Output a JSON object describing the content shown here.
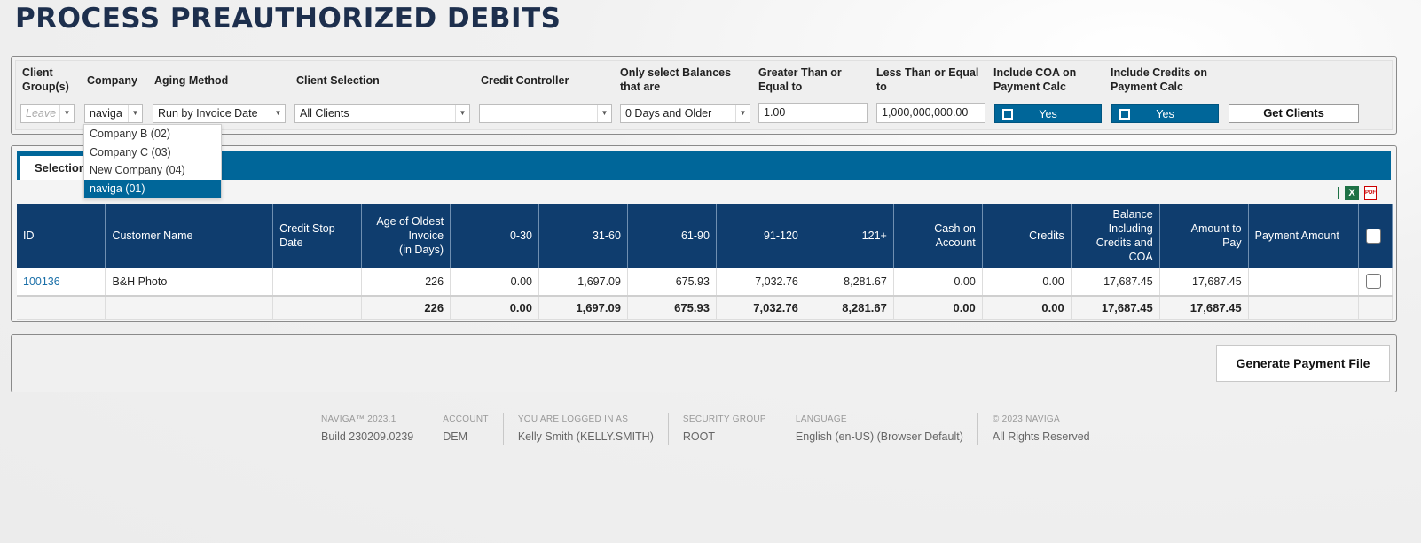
{
  "page": {
    "title": "PROCESS PREAUTHORIZED DEBITS"
  },
  "filters": {
    "client_groups": {
      "label_line1": "Client",
      "label_line2": "Group(s)",
      "placeholder": "Leave ..."
    },
    "company": {
      "label": "Company",
      "value": "naviga"
    },
    "aging_method": {
      "label": "Aging Method",
      "value": "Run by Invoice Date"
    },
    "client_selection": {
      "label": "Client Selection",
      "value": "All Clients"
    },
    "credit_controller": {
      "label": "Credit Controller",
      "value": ""
    },
    "balances": {
      "label_line1": "Only select Balances",
      "label_line2": "that are",
      "value": "0 Days and Older"
    },
    "greater_than": {
      "label_line1": "Greater Than or",
      "label_line2": "Equal to",
      "value": "1.00"
    },
    "less_than": {
      "label_line1": "Less Than or Equal",
      "label_line2": "to",
      "value": "1,000,000,000.00"
    },
    "include_coa": {
      "label_line1": "Include COA on",
      "label_line2": "Payment Calc",
      "value": "Yes"
    },
    "include_credits": {
      "label_line1": "Include Credits on",
      "label_line2": "Payment Calc",
      "value": "Yes"
    },
    "get_clients_label": "Get Clients"
  },
  "company_dropdown": {
    "options": [
      {
        "label": "Company B (02)",
        "selected": false
      },
      {
        "label": "Company C (03)",
        "selected": false
      },
      {
        "label": "New Company (04)",
        "selected": false
      },
      {
        "label": "naviga (01)",
        "selected": true
      }
    ]
  },
  "results": {
    "tab_label": "Selection",
    "headers": {
      "id": "ID",
      "customer_name": "Customer Name",
      "credit_stop_l1": "Credit Stop",
      "credit_stop_l2": "Date",
      "age_l1": "Age of Oldest",
      "age_l2": "Invoice",
      "age_l3": "(in Days)",
      "b0_30": "0-30",
      "b31_60": "31-60",
      "b61_90": "61-90",
      "b91_120": "91-120",
      "b121": "121+",
      "coa_l1": "Cash on",
      "coa_l2": "Account",
      "credits": "Credits",
      "bal_l1": "Balance",
      "bal_l2": "Including",
      "bal_l3": "Credits and",
      "bal_l4": "COA",
      "amt_l1": "Amount to",
      "amt_l2": "Pay",
      "payment_amount": "Payment Amount"
    },
    "rows": [
      {
        "id": "100136",
        "customer_name": "B&H Photo",
        "credit_stop_date": "",
        "age": "226",
        "b0_30": "0.00",
        "b31_60": "1,697.09",
        "b61_90": "675.93",
        "b91_120": "7,032.76",
        "b121": "8,281.67",
        "coa": "0.00",
        "credits": "0.00",
        "balance": "17,687.45",
        "amount_to_pay": "17,687.45",
        "payment_amount": ""
      }
    ],
    "totals": {
      "age": "226",
      "b0_30": "0.00",
      "b31_60": "1,697.09",
      "b61_90": "675.93",
      "b91_120": "7,032.76",
      "b121": "8,281.67",
      "coa": "0.00",
      "credits": "0.00",
      "balance": "17,687.45",
      "amount_to_pay": "17,687.45"
    },
    "export_icons": [
      "excel-icon",
      "pdf-icon"
    ]
  },
  "actions": {
    "generate_label": "Generate Payment File"
  },
  "footer": {
    "product": {
      "head": "NAVIGA™ 2023.1",
      "value": "Build 230209.0239"
    },
    "account": {
      "head": "ACCOUNT",
      "value": "DEM"
    },
    "user": {
      "head": "YOU ARE LOGGED IN AS",
      "value": "Kelly Smith (KELLY.SMITH)"
    },
    "security": {
      "head": "SECURITY GROUP",
      "value": "ROOT"
    },
    "language": {
      "head": "LANGUAGE",
      "value": "English (en-US) (Browser Default)"
    },
    "copyright": {
      "head": "© 2023 NAVIGA",
      "value": "All Rights Reserved"
    }
  },
  "colors": {
    "accent": "#006699",
    "header": "#0f3d6e",
    "title": "#1d2f4d"
  }
}
